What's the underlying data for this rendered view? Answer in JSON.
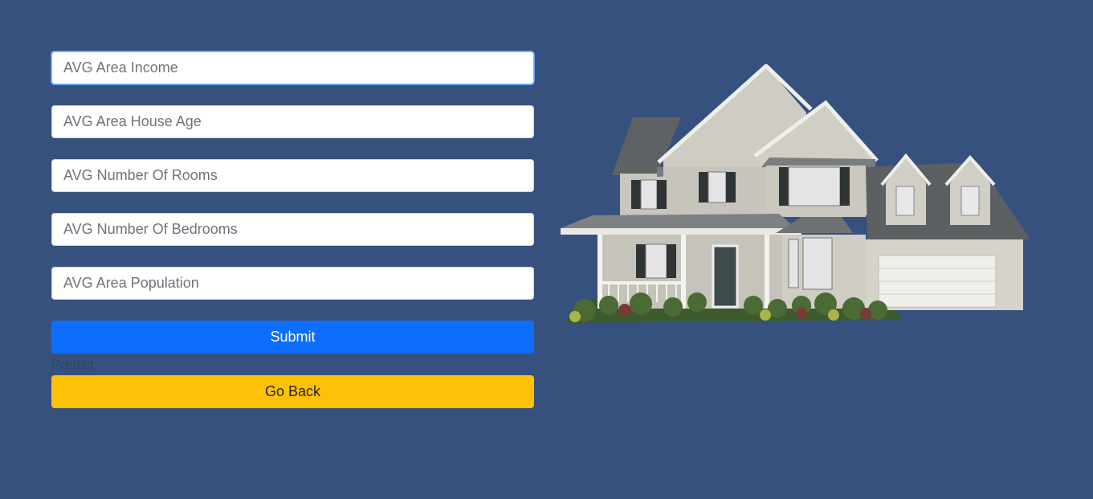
{
  "form": {
    "fields": [
      {
        "placeholder": "AVG Area Income",
        "value": ""
      },
      {
        "placeholder": "AVG Area House Age",
        "value": ""
      },
      {
        "placeholder": "AVG Number Of Rooms",
        "value": ""
      },
      {
        "placeholder": "AVG Number Of Bedrooms",
        "value": ""
      },
      {
        "placeholder": "AVG Area Population",
        "value": ""
      }
    ],
    "submit_label": "Submit",
    "predict_text": "Predict",
    "back_label": "Go Back"
  },
  "colors": {
    "background": "#37517e",
    "submit": "#0d6efd",
    "back": "#ffc107"
  },
  "image": {
    "icon": "house-image"
  }
}
